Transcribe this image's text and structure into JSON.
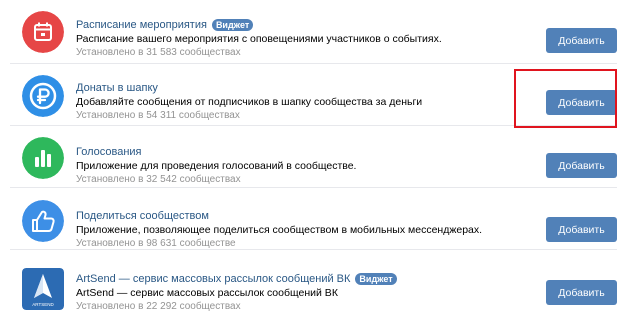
{
  "apps": [
    {
      "title": "Расписание мероприятия",
      "badge": "Виджет",
      "description": "Расписание вашего мероприятия с оповещениями участников о событиях.",
      "installed": "Установлено в 31 583 сообществах",
      "button": "Добавить",
      "icon": "calendar-icon",
      "icon_color": "#e64646"
    },
    {
      "title": "Донаты в шапку",
      "badge": "",
      "description": "Добавляйте сообщения от подписчиков в шапку сообщества за деньги",
      "installed": "Установлено в 54 311 сообществах",
      "button": "Добавить",
      "icon": "ruble-coin-icon",
      "icon_color": "#2f8fe6"
    },
    {
      "title": "Голосования",
      "badge": "",
      "description": "Приложение для проведения голосований в сообществе.",
      "installed": "Установлено в 32 542 сообществах",
      "button": "Добавить",
      "icon": "bar-chart-icon",
      "icon_color": "#2eb85c"
    },
    {
      "title": "Поделиться сообществом",
      "badge": "",
      "description": "Приложение, позволяющее поделиться сообществом в мобильных мессенджерах.",
      "installed": "Установлено в 98 631 сообществе",
      "button": "Добавить",
      "icon": "thumbs-up-icon",
      "icon_color": "#3d8fe6"
    },
    {
      "title": "ArtSend — сервис массовых рассылок сообщений ВК",
      "badge": "Виджет",
      "description": "ArtSend — сервис массовых рассылок сообщений ВК",
      "installed": "Установлено в 22 292 сообществах",
      "button": "Добавить",
      "icon": "artsend-logo-icon",
      "icon_color": "#2c6bb3",
      "logo_text": "ARTSEND"
    }
  ],
  "colors": {
    "accent": "#5181b8",
    "link": "#2a5885",
    "highlight": "#e0141e"
  }
}
